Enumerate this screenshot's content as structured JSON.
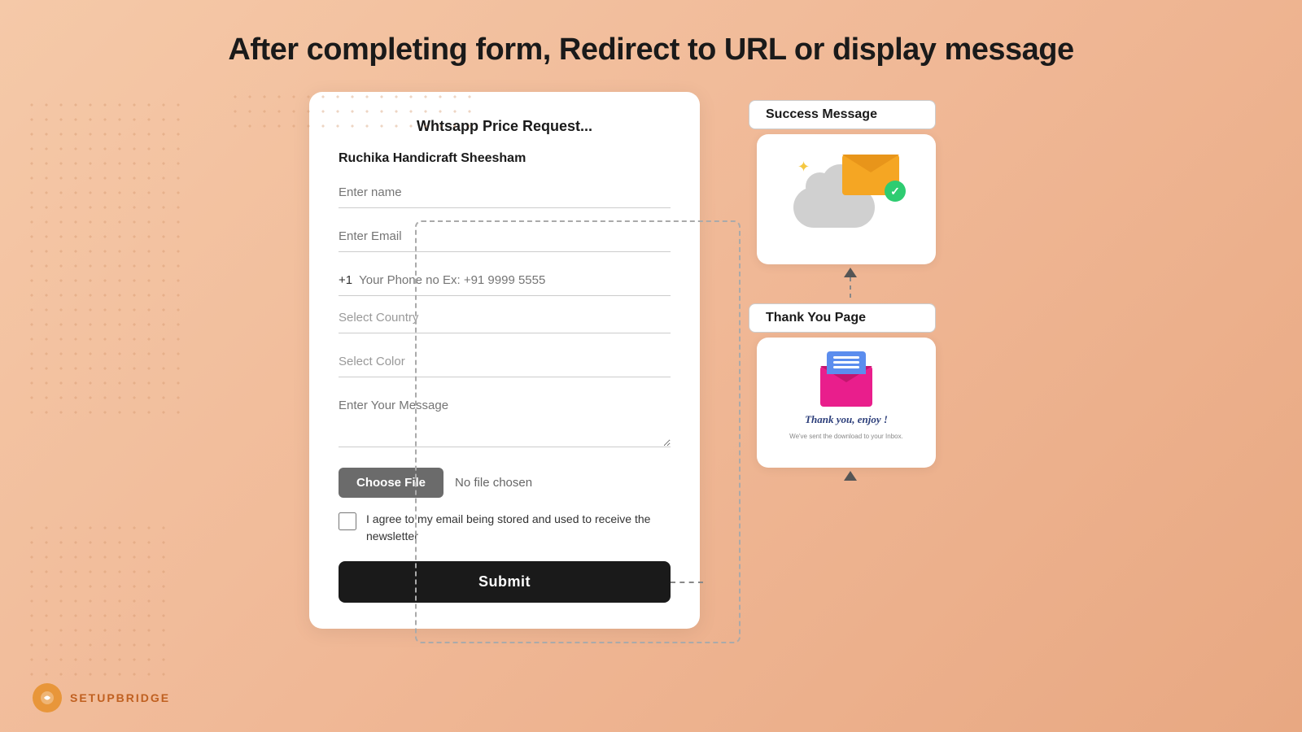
{
  "page": {
    "title": "After completing form, Redirect to URL or display message",
    "background_color": "#f5c9a8"
  },
  "form": {
    "title": "Whtsapp Price Request...",
    "product_name": "Ruchika Handicraft Sheesham",
    "fields": {
      "name_placeholder": "Enter name",
      "email_placeholder": "Enter Email",
      "phone_prefix": "+1",
      "phone_placeholder": "Your Phone no Ex: +91 9999 5555",
      "country_placeholder": "Select Country",
      "color_placeholder": "Select Color",
      "message_placeholder": "Enter Your Message"
    },
    "file_upload": {
      "button_label": "Choose File",
      "no_file_text": "No file chosen"
    },
    "checkbox_label": "I agree to my email being stored and used to receive the newsletter",
    "submit_label": "Submit"
  },
  "flow": {
    "success_label": "Success Message",
    "thankyou_label": "Thank You Page",
    "thankyou_text": "Thank you, enjoy !",
    "thankyou_sub": "We've sent the download to your Inbox."
  },
  "logo": {
    "text": "SETUPBRIDGE"
  }
}
